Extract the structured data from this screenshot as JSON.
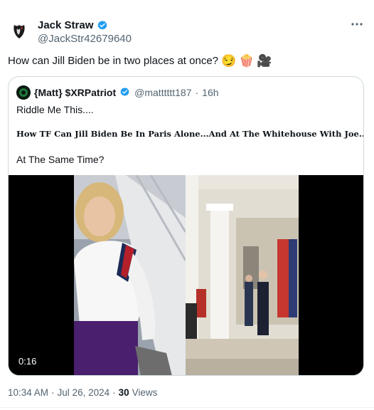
{
  "author": {
    "display_name": "Jack Straw",
    "handle": "@JackStr42679640",
    "verified": true
  },
  "tweet": {
    "text": "How can Jill Biden be in two places at once?",
    "emojis": [
      "😏",
      "🍿",
      "🎥"
    ]
  },
  "quoted": {
    "display_name": "{Matt} $XRPatriot",
    "handle": "@matttttt187",
    "separator": "·",
    "time": "16h",
    "line1": "Riddle Me This....",
    "line2": "How TF Can Jill Biden Be In Paris Alone...And At The Whitehouse With Joe....",
    "line3": "At The Same Time?",
    "video_duration": "0:16"
  },
  "footer": {
    "time": "10:34 AM",
    "separator": "·",
    "date": "Jul 26, 2024",
    "separator2": "·",
    "views_count": "30",
    "views_label": "Views"
  },
  "icons": {
    "more": "more-horizontal-icon",
    "verified": "verified-badge-icon"
  },
  "colors": {
    "verified_blue": "#1d9bf0",
    "secondary_text": "#536471",
    "border": "#cfd9de"
  }
}
